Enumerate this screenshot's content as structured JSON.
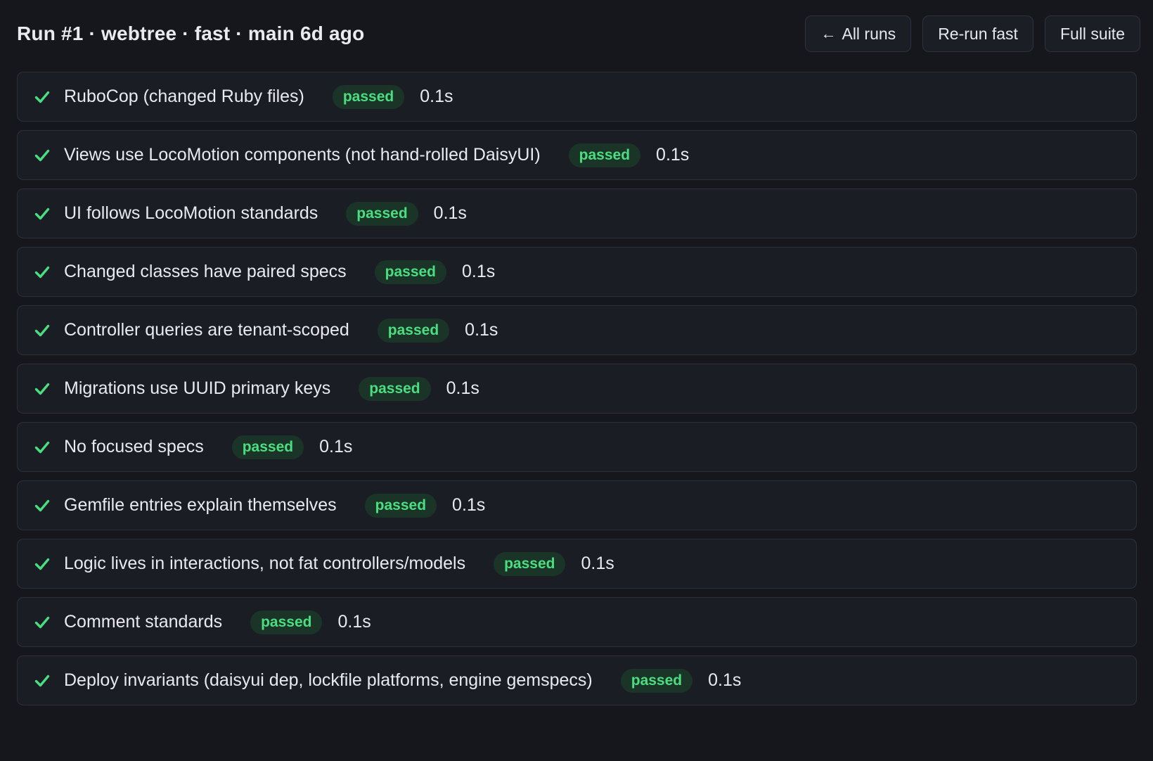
{
  "header": {
    "title": "Run #1 · webtree · fast · main 6d ago",
    "buttons": {
      "all_runs": {
        "icon": "arrow-left-icon",
        "icon_glyph": "←",
        "label": "All runs"
      },
      "rerun_fast": {
        "label": "Re-run fast"
      },
      "full_suite": {
        "label": "Full suite"
      }
    }
  },
  "colors": {
    "background": "#15171d",
    "row_background": "#1b1d24",
    "row_border": "#2c3039",
    "success": "#4ade80",
    "badge_background": "#1a3527"
  },
  "checks": [
    {
      "name": "RuboCop (changed Ruby files)",
      "status": "passed",
      "duration": "0.1s",
      "icon": "check-icon"
    },
    {
      "name": "Views use LocoMotion components (not hand-rolled DaisyUI)",
      "status": "passed",
      "duration": "0.1s",
      "icon": "check-icon"
    },
    {
      "name": "UI follows LocoMotion standards",
      "status": "passed",
      "duration": "0.1s",
      "icon": "check-icon"
    },
    {
      "name": "Changed classes have paired specs",
      "status": "passed",
      "duration": "0.1s",
      "icon": "check-icon"
    },
    {
      "name": "Controller queries are tenant-scoped",
      "status": "passed",
      "duration": "0.1s",
      "icon": "check-icon"
    },
    {
      "name": "Migrations use UUID primary keys",
      "status": "passed",
      "duration": "0.1s",
      "icon": "check-icon"
    },
    {
      "name": "No focused specs",
      "status": "passed",
      "duration": "0.1s",
      "icon": "check-icon"
    },
    {
      "name": "Gemfile entries explain themselves",
      "status": "passed",
      "duration": "0.1s",
      "icon": "check-icon"
    },
    {
      "name": "Logic lives in interactions, not fat controllers/models",
      "status": "passed",
      "duration": "0.1s",
      "icon": "check-icon"
    },
    {
      "name": "Comment standards",
      "status": "passed",
      "duration": "0.1s",
      "icon": "check-icon"
    },
    {
      "name": "Deploy invariants (daisyui dep, lockfile platforms, engine gemspecs)",
      "status": "passed",
      "duration": "0.1s",
      "icon": "check-icon"
    }
  ]
}
